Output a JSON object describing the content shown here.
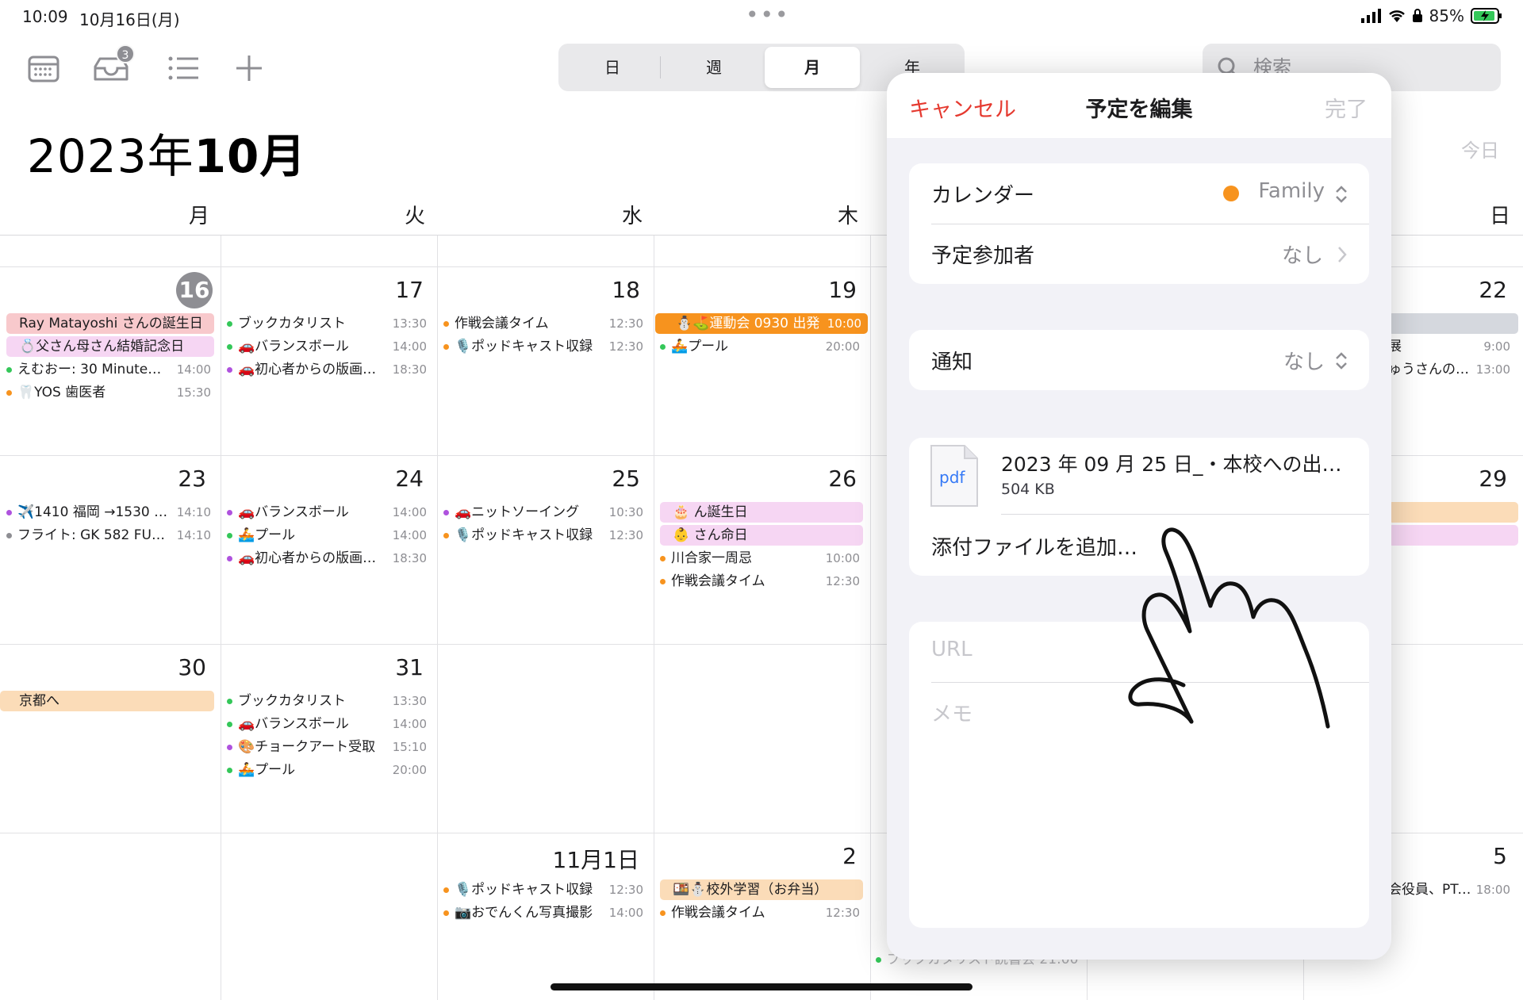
{
  "status": {
    "time": "10:09",
    "date": "10月16日(月)",
    "battery": "85%"
  },
  "toolbar": {
    "inbox_badge": "3",
    "search_placeholder": "検索"
  },
  "view_tabs": [
    "日",
    "週",
    "月",
    "年"
  ],
  "header": {
    "year": "2023",
    "year_suffix": "年",
    "month": "10月",
    "today_label": "今日"
  },
  "weekdays": [
    "月",
    "火",
    "水",
    "木",
    "日"
  ],
  "days": {
    "r1": [
      "16",
      "17",
      "18",
      "19",
      "22"
    ],
    "r2": [
      "23",
      "24",
      "25",
      "26",
      "29"
    ],
    "r3": [
      "30",
      "31"
    ],
    "r4": [
      "11月1日",
      "2",
      "5"
    ]
  },
  "events": {
    "mon16": {
      "a1": "Ray Matayoshi さんの誕生日",
      "a2": "💍父さん母さん結婚記念日",
      "e1": "えむおー: 30 Minute…",
      "e1t": "14:00",
      "e2": "🦷YOS 歯医者",
      "e2t": "15:30"
    },
    "tue17": {
      "e1": "ブックカタリスト",
      "e1t": "13:30",
      "e2": "🚗バランスボール",
      "e2t": "14:00",
      "e3": "🚗初心者からの版画…",
      "e3t": "18:30"
    },
    "wed18": {
      "e1": "作戦会議タイム",
      "e1t": "12:30",
      "e2": "🎙️ポッドキャスト収録",
      "e2t": "12:30"
    },
    "thu19": {
      "a1": "⛄⛳運動会 0930 出発",
      "a1t": "10:00",
      "e1": "🚣プール",
      "e1t": "20:00"
    },
    "sun22": {
      "e1": "展",
      "e1t": "9:00",
      "e2": "ゅうさんの家へ",
      "e2t": "13:00"
    },
    "mon23": {
      "e1": "✈️1410 福岡 →1530 名…",
      "e1t": "14:10",
      "e2": "フライト: GK 582 FUK…",
      "e2t": "14:10"
    },
    "tue24": {
      "e1": "🚗バランスボール",
      "e1t": "14:00",
      "e2": "🚣プール",
      "e2t": "14:00",
      "e3": "🚗初心者からの版画…",
      "e3t": "18:30"
    },
    "wed25": {
      "e1": "🚗ニットソーイング",
      "e1t": "10:30",
      "e2": "🎙️ポッドキャスト収録",
      "e2t": "12:30"
    },
    "thu26": {
      "a1": "🎂 ん誕生日",
      "a2": "👶 さん命日",
      "e1": "川合家一周忌",
      "e1t": "10:00",
      "e2": "作戦会議タイム",
      "e2t": "12:30"
    },
    "mon30": {
      "a1": "京都へ"
    },
    "tue31": {
      "e1": "ブックカタリスト",
      "e1t": "13:30",
      "e2": "🚗バランスボール",
      "e2t": "14:00",
      "e3": "🎨チョークアート受取",
      "e3t": "15:10",
      "e4": "🚣プール",
      "e4t": "20:00"
    },
    "wed1": {
      "e1": "🎙️ポッドキャスト収録",
      "e1t": "12:30",
      "e2": "📷おでんくん写真撮影",
      "e2t": "14:00"
    },
    "thu2": {
      "a1": "🍱⛄校外学習（お弁当）",
      "e1": "作戦会議タイム",
      "e1t": "12:30"
    },
    "sun5": {
      "e1": "会役員、PTA …",
      "e1t": "18:00"
    },
    "hidden_fri": "ブックカタリスト読書会 21:00"
  },
  "edit_panel": {
    "cancel": "キャンセル",
    "title": "予定を編集",
    "done": "完了",
    "calendar_label": "カレンダー",
    "calendar_value": "Family",
    "calendar_color": "#f7931e",
    "invitees_label": "予定参加者",
    "invitees_value": "なし",
    "alert_label": "通知",
    "alert_value": "なし",
    "attachment_type": "pdf",
    "attachment_name": "2023 年 09 月 25 日_・本校への出…",
    "attachment_size": "504 KB",
    "add_attachment": "添付ファイルを追加…",
    "url_placeholder": "URL",
    "notes_placeholder": "メモ"
  },
  "colors": {
    "accent_red": "#e5392f",
    "orange": "#f7931e",
    "green": "#34c759",
    "purple": "#af52de"
  }
}
